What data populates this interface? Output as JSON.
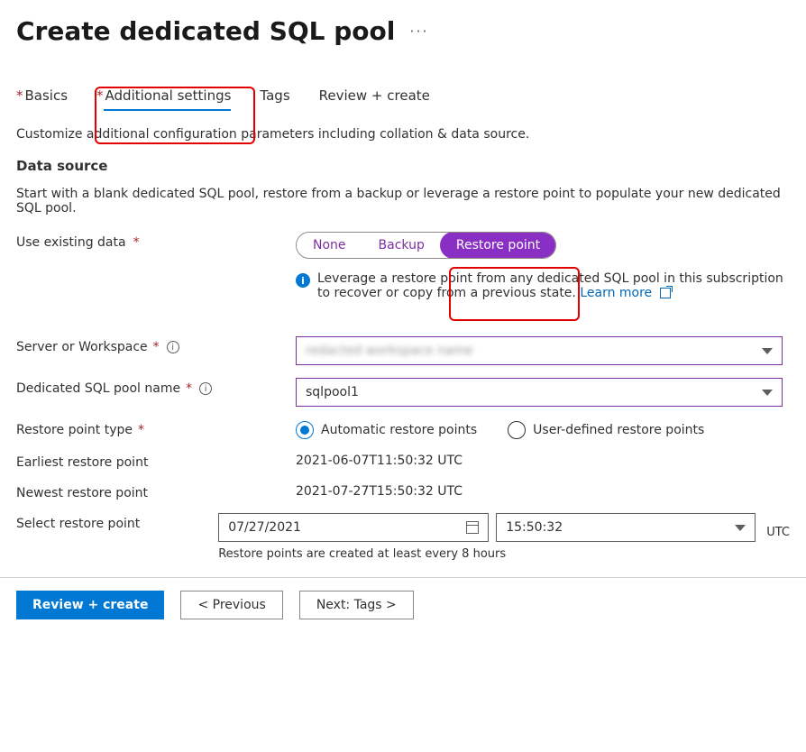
{
  "title": "Create dedicated SQL pool",
  "tabs": {
    "basics": "Basics",
    "additional": "Additional settings",
    "tags": "Tags",
    "review": "Review + create"
  },
  "descriptions": {
    "intro": "Customize additional configuration parameters including collation & data source.",
    "data_source_heading": "Data source",
    "data_source_text": "Start with a blank dedicated SQL pool, restore from a backup or leverage a restore point to populate your new dedicated SQL pool."
  },
  "labels": {
    "use_existing_data": "Use existing data",
    "server_or_workspace": "Server or Workspace",
    "pool_name": "Dedicated SQL pool name",
    "restore_point_type": "Restore point type",
    "earliest": "Earliest restore point",
    "newest": "Newest restore point",
    "select_restore_point": "Select restore point"
  },
  "segmented": {
    "none": "None",
    "backup": "Backup",
    "restore_point": "Restore point"
  },
  "info": {
    "text": "Leverage a restore point from any dedicated SQL pool in this subscription to recover or copy from a previous state.",
    "learn_more": "Learn more"
  },
  "values": {
    "server_or_workspace": "redacted workspace name",
    "pool_name": "sqlpool1",
    "earliest": "2021-06-07T11:50:32 UTC",
    "newest": "2021-07-27T15:50:32 UTC",
    "date": "07/27/2021",
    "time": "15:50:32",
    "utc": "UTC",
    "restore_note": "Restore points are created at least every 8 hours"
  },
  "radio": {
    "automatic": "Automatic restore points",
    "user": "User-defined restore points"
  },
  "footer": {
    "review_create": "Review + create",
    "previous": "< Previous",
    "next": "Next: Tags >"
  }
}
